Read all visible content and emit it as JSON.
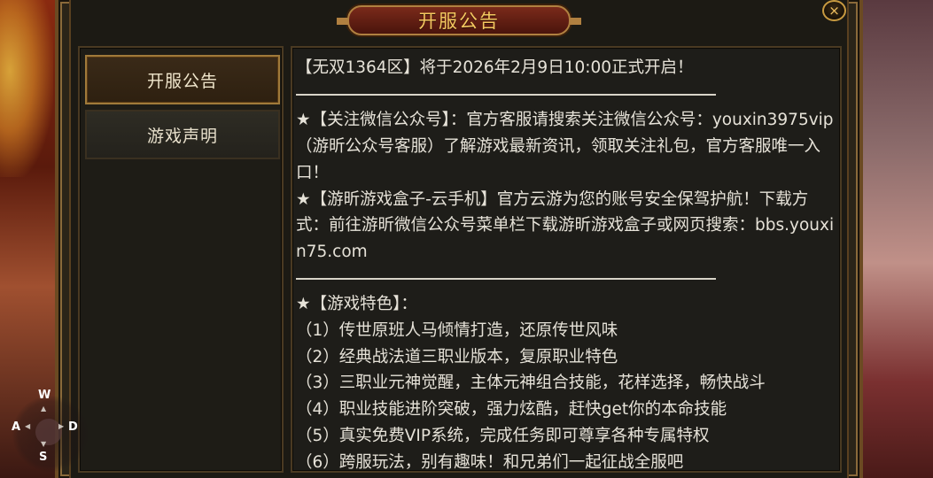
{
  "dialog": {
    "title": "开服公告",
    "close_icon": "×"
  },
  "sidebar": {
    "items": [
      {
        "label": "开服公告",
        "active": true
      },
      {
        "label": "游戏声明",
        "active": false
      }
    ]
  },
  "content": {
    "announce": "【无双1364区】将于2026年2月9日10:00正式开启！",
    "wechat": "★【关注微信公众号】：官方客服请搜索关注微信公众号：youxin3975vip（游昕公众号客服）了解游戏最新资讯，领取关注礼包，官方客服唯一入口！",
    "cloud": "★【游昕游戏盒子-云手机】官方云游为您的账号安全保驾护航！下载方式：前往游昕微信公众号菜单栏下载游昕游戏盒子或网页搜索：bbs.youxin75.com",
    "features_title": "★【游戏特色】：",
    "features": [
      "（1）传世原班人马倾情打造，还原传世风味",
      "（2）经典战法道三职业版本，复原职业特色",
      "（3）三职业元神觉醒，主体元神组合技能，花样选择，畅快战斗",
      "（4）职业技能进阶突破，强力炫酷，赶快get你的本命技能",
      "（5）真实免费VIP系统，完成任务即可尊享各种专属特权",
      "（6）跨服玩法，别有趣味！和兄弟们一起征战全服吧"
    ]
  },
  "joystick": {
    "up": "W",
    "left": "A",
    "right": "D",
    "down": "S"
  },
  "colors": {
    "title_gold": "#f4c860",
    "panel_bg": "#1e1d19",
    "text": "#e6e2d8",
    "border_gold": "#a07a3a"
  }
}
